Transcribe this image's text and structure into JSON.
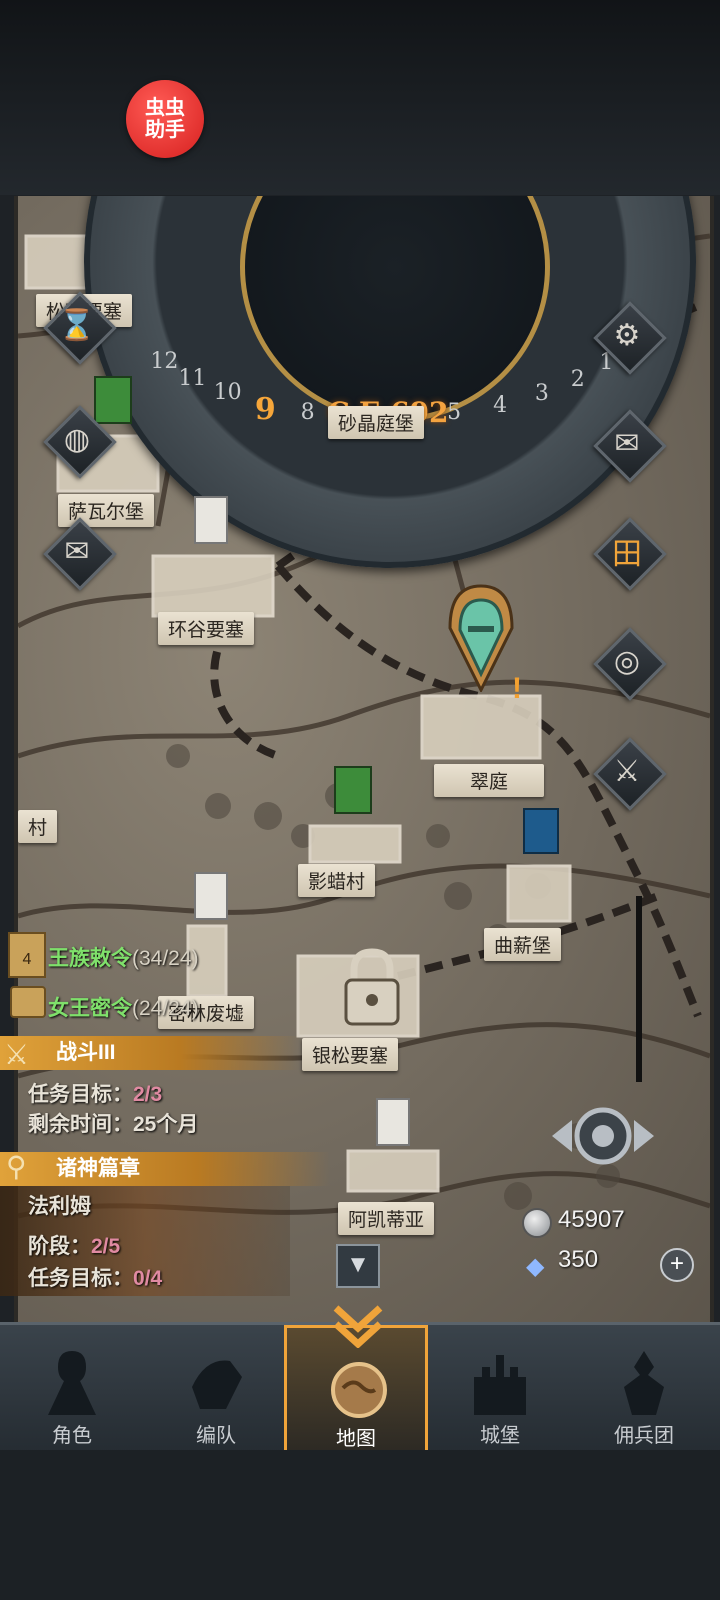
{
  "overlay_badge": {
    "text": "虫虫助手"
  },
  "calendar": {
    "year": "C.E.692",
    "months": [
      "1",
      "2",
      "3",
      "4",
      "5",
      "6",
      "7",
      "8",
      "9",
      "10",
      "11",
      "12"
    ],
    "current_month": "9"
  },
  "castles": [
    "松石要塞",
    "砂晶庭堡",
    "萨瓦尔堡",
    "环谷要塞",
    "翠庭",
    "影蜡村",
    "曲薪堡",
    "密林废墟",
    "银松要塞",
    "阿凯蒂亚",
    "村"
  ],
  "side_buttons": [
    {
      "name": "hourglass-icon"
    },
    {
      "name": "bag-icon"
    },
    {
      "name": "scroll-icon"
    },
    {
      "name": "gear-icon"
    },
    {
      "name": "mail-icon"
    },
    {
      "name": "grid-icon"
    },
    {
      "name": "coin-icon"
    },
    {
      "name": "knight-icon"
    }
  ],
  "quests": {
    "royal_edict": {
      "label": "王族敕令",
      "count": "(34/24)",
      "badge": "4"
    },
    "queen_order": {
      "label": "女王密令",
      "count": "(24/24)"
    },
    "battle": {
      "title": "战斗III",
      "target_label": "任务目标：",
      "target_value": "2/3",
      "time_label": "剩余时间：",
      "time_value": "25个月"
    },
    "gods": {
      "title": "诸神篇章",
      "hero": "法利姆",
      "stage_label": "阶段：",
      "stage_value": "2/5",
      "target_label": "任务目标：",
      "target_value": "0/4"
    }
  },
  "resources": {
    "silver": "45907",
    "crystal": "350"
  },
  "nav": [
    {
      "label": "角色"
    },
    {
      "label": "编队"
    },
    {
      "label": "地图"
    },
    {
      "label": "城堡"
    },
    {
      "label": "佣兵团"
    }
  ],
  "active_tab": "地图"
}
